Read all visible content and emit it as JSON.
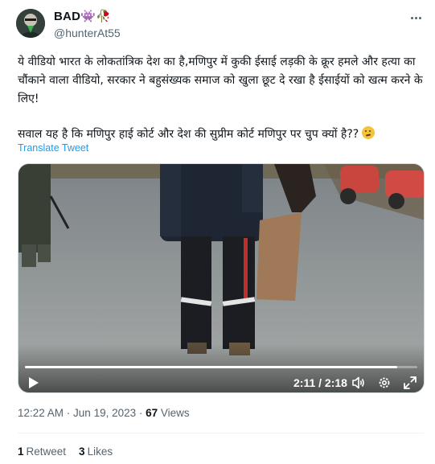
{
  "author": {
    "display_name": "BAD👾🥀",
    "handle": "@hunterAt55",
    "avatar_icon": "avatar-icon"
  },
  "tweet": {
    "line1": "ये वीडियो भारत के लोकतांत्रिक देश का है,मणिपुर में कुकी ईसाई लड़की के क्रूर हमले और हत्या का चौंकाने वाला वीडियो, सरकार ने बहुसंख्यक समाज को खुला छूट दे रखा है ईसाईयों को खत्म करने के लिए!",
    "line2": "सवाल यह है कि मणिपुर हाई कोर्ट और देश की सुप्रीम कोर्ट मणिपुर पर चुप क्यों है??",
    "emoji_icon": "thinking-face-icon",
    "translate_label": "Translate Tweet"
  },
  "video": {
    "current_time": "2:11",
    "separator": " / ",
    "duration": "2:18",
    "progress_fraction": 0.949
  },
  "meta": {
    "time": "12:22 AM",
    "sep": " · ",
    "date": "Jun 19, 2023",
    "sep2": " · ",
    "views_count": "67",
    "views_label": " Views"
  },
  "stats": {
    "retweets_count": "1",
    "retweets_label": "Retweet",
    "likes_count": "3",
    "likes_label": "Likes"
  },
  "colors": {
    "accent": "#1d9bf0",
    "secondary_text": "#536471",
    "primary_text": "#0f1419"
  }
}
